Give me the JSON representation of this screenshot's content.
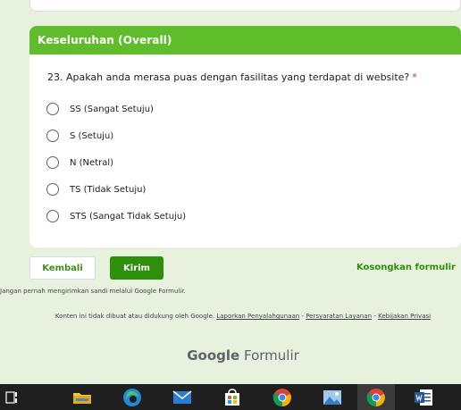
{
  "section": {
    "title": "Keseluruhan (Overall)"
  },
  "question": {
    "text": "23. Apakah anda merasa puas dengan fasilitas yang terdapat di website?",
    "required_marker": "*",
    "options": [
      "SS (Sangat Setuju)",
      "S (Setuju)",
      "N (Netral)",
      "TS (Tidak Setuju)",
      "STS (Sangat Tidak Setuju)"
    ]
  },
  "actions": {
    "back_label": "Kembali",
    "submit_label": "Kirim",
    "clear_label": "Kosongkan formulir"
  },
  "notice": "Jangan pernah mengirimkan sandi melalui Google Formulir.",
  "footer": {
    "text": "Konten ini tidak dibuat atau didukung oleh Google.",
    "report_link": "Laporkan Penyalahgunaan",
    "sep1": "-",
    "terms_link": "Persyaratan Layanan",
    "sep2": "-",
    "privacy_link": "Kebijakan Privasi"
  },
  "brand": {
    "bold": "Google",
    "light": "Formulir"
  },
  "taskbar": {
    "items": [
      "task-view-icon",
      "file-explorer-icon",
      "edge-icon",
      "mail-icon",
      "store-icon",
      "chrome-icon",
      "photos-icon",
      "chrome-alt-icon",
      "word-icon"
    ]
  },
  "colors": {
    "accent": "#5fbd2b",
    "button": "#2e8f0b",
    "background": "#e8f1dd"
  }
}
